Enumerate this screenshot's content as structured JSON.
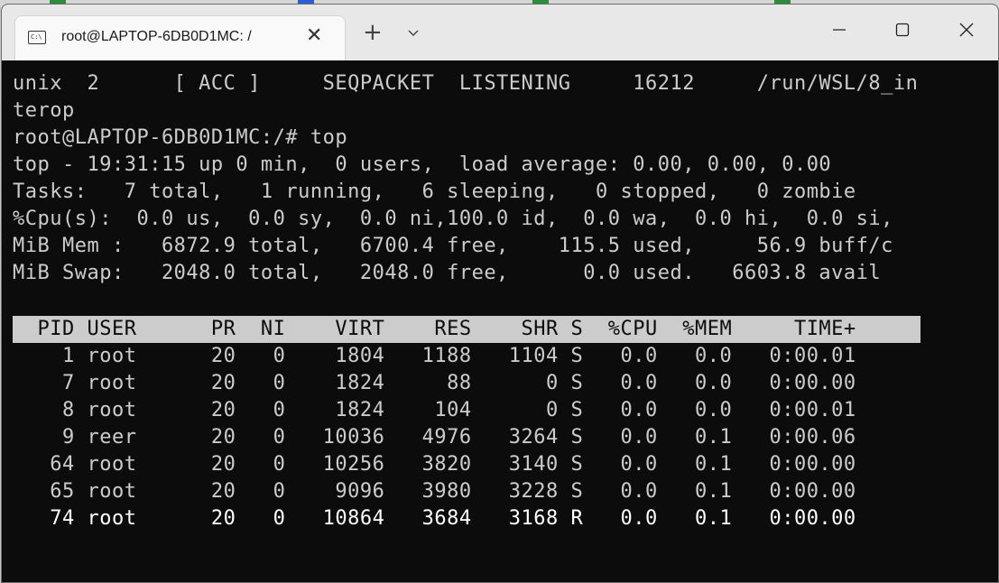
{
  "window": {
    "tab_title": "root@LAPTOP-6DB0D1MC: /",
    "tab_icon_text": "C:\\",
    "new_tab_glyph": "+",
    "close_glyph": "✕"
  },
  "terminal": {
    "lines": [
      "unix  2      [ ACC ]     SEQPACKET  LISTENING     16212     /run/WSL/8_in",
      "terop",
      "root@LAPTOP-6DB0D1MC:/# top",
      "top - 19:31:15 up 0 min,  0 users,  load average: 0.00, 0.00, 0.00",
      "Tasks:   7 total,   1 running,   6 sleeping,   0 stopped,   0 zombie",
      "%Cpu(s):  0.0 us,  0.0 sy,  0.0 ni,100.0 id,  0.0 wa,  0.0 hi,  0.0 si,",
      "MiB Mem :   6872.9 total,   6700.4 free,    115.5 used,     56.9 buff/c",
      "MiB Swap:   2048.0 total,   2048.0 free,      0.0 used.   6603.8 avail",
      "",
      "  PID USER      PR  NI    VIRT    RES    SHR S  %CPU  %MEM     TIME+ ",
      "    1 root      20   0    1804   1188   1104 S   0.0   0.0   0:00.01",
      "    7 root      20   0    1824     88      0 S   0.0   0.0   0:00.00",
      "    8 root      20   0    1824    104      0 S   0.0   0.0   0:00.01",
      "    9 reer      20   0   10036   4976   3264 S   0.0   0.1   0:00.06",
      "   64 root      20   0   10256   3820   3140 S   0.0   0.1   0:00.00",
      "   65 root      20   0    9096   3980   3228 S   0.0   0.1   0:00.00",
      "   74 root      20   0   10864   3684   3168 R   0.0   0.1   0:00.00"
    ]
  }
}
